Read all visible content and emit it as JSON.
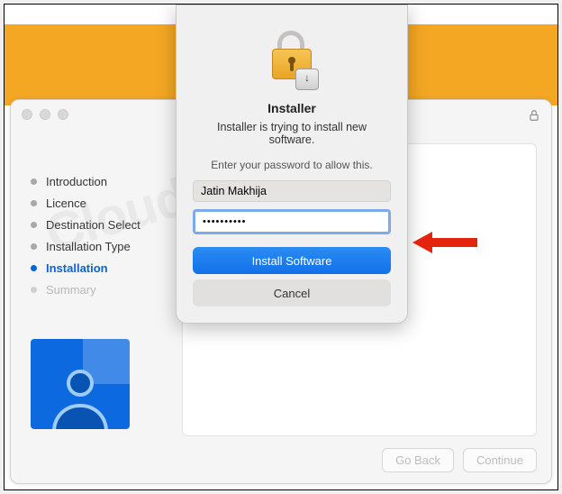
{
  "sidebar": {
    "items": [
      {
        "label": "Introduction"
      },
      {
        "label": "Licence"
      },
      {
        "label": "Destination Select"
      },
      {
        "label": "Installation Type"
      },
      {
        "label": "Installation"
      },
      {
        "label": "Summary"
      }
    ]
  },
  "footer": {
    "back": "Go Back",
    "continue": "Continue"
  },
  "dialog": {
    "title": "Installer",
    "subtitle": "Installer is trying to install new software.",
    "hint": "Enter your password to allow this.",
    "username": "Jatin Makhija",
    "password_mask": "••••••••••",
    "primary": "Install Software",
    "secondary": "Cancel"
  },
  "watermark": "Cloudinfra.net"
}
